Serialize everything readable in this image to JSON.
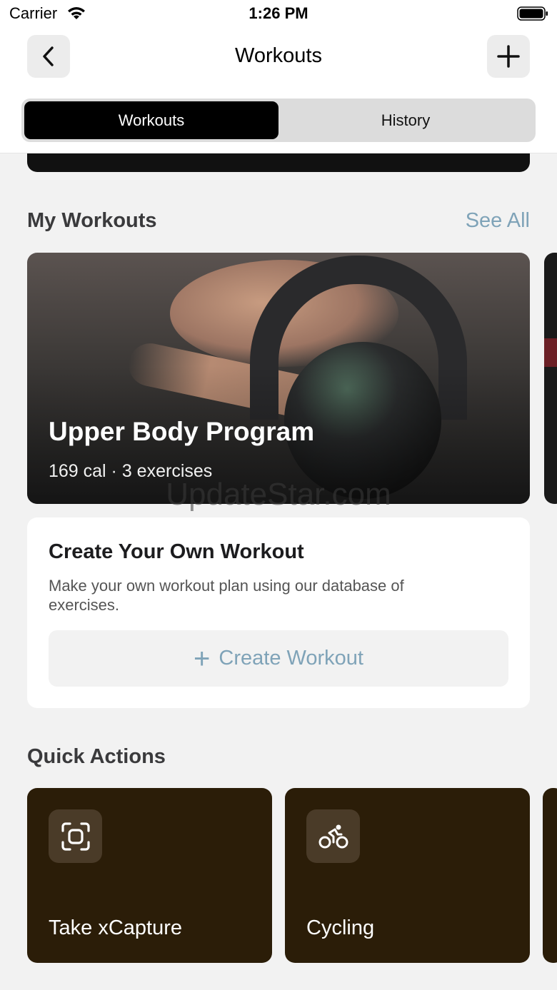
{
  "status_bar": {
    "carrier": "Carrier",
    "time": "1:26 PM"
  },
  "nav": {
    "title": "Workouts"
  },
  "tabs": [
    {
      "label": "Workouts",
      "active": true
    },
    {
      "label": "History",
      "active": false
    }
  ],
  "my_workouts": {
    "title": "My Workouts",
    "see_all": "See All",
    "card": {
      "title": "Upper Body Program",
      "meta": "169 cal · 3 exercises"
    }
  },
  "watermark": "UpdateStar.com",
  "create": {
    "title": "Create Your Own Workout",
    "description": "Make your own workout plan using our database of exercises.",
    "button_label": "Create Workout",
    "button_icon": "+"
  },
  "quick_actions": {
    "title": "Quick Actions",
    "items": [
      {
        "label": "Take xCapture",
        "icon": "scan-icon"
      },
      {
        "label": "Cycling",
        "icon": "cycling-icon"
      }
    ]
  },
  "colors": {
    "accent": "#7fa3b8",
    "action_card": "#2b1d08",
    "segment_active": "#000000"
  }
}
